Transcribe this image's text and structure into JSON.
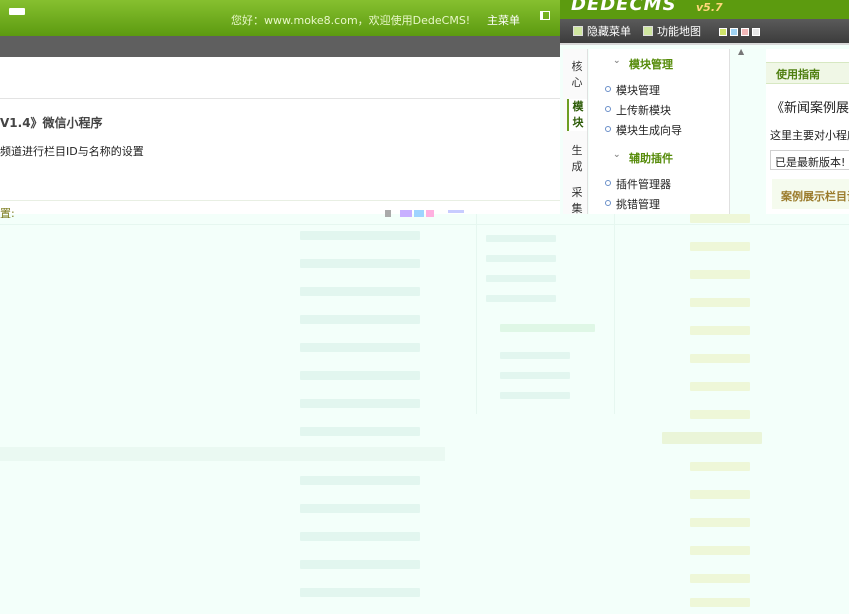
{
  "left_window": {
    "welcome": "您好：www.moke8.com，欢迎使用DedeCMS!",
    "main_menu": "主菜单",
    "module_title": "V1.4》微信小程序",
    "description": "频道进行栏目ID与名称的设置",
    "settings_label": "置:"
  },
  "right_window": {
    "logo": "DEDECMS",
    "version": "v5.7",
    "toolbar": {
      "hide_menu": "隐藏菜单",
      "site_map": "功能地图"
    },
    "vertical_tabs": [
      "核心",
      "模块",
      "生成",
      "采集"
    ],
    "menu": {
      "group1_title": "模块管理",
      "group1_items": [
        "模块管理",
        "上传新模块",
        "模块生成向导"
      ],
      "group2_title": "辅助插件",
      "group2_items": [
        "插件管理器",
        "挑错管理"
      ]
    },
    "content": {
      "guide_label": "使用指南",
      "article_title": "《新闻案例展示",
      "intro": "这里主要对小程序",
      "version_status": "已是最新版本!",
      "category_label": "案例展示栏目设"
    }
  },
  "colors": {
    "header_green": "#5c9b0f",
    "accent_green": "#578c0b",
    "bg_mint": "#f3fffa"
  }
}
